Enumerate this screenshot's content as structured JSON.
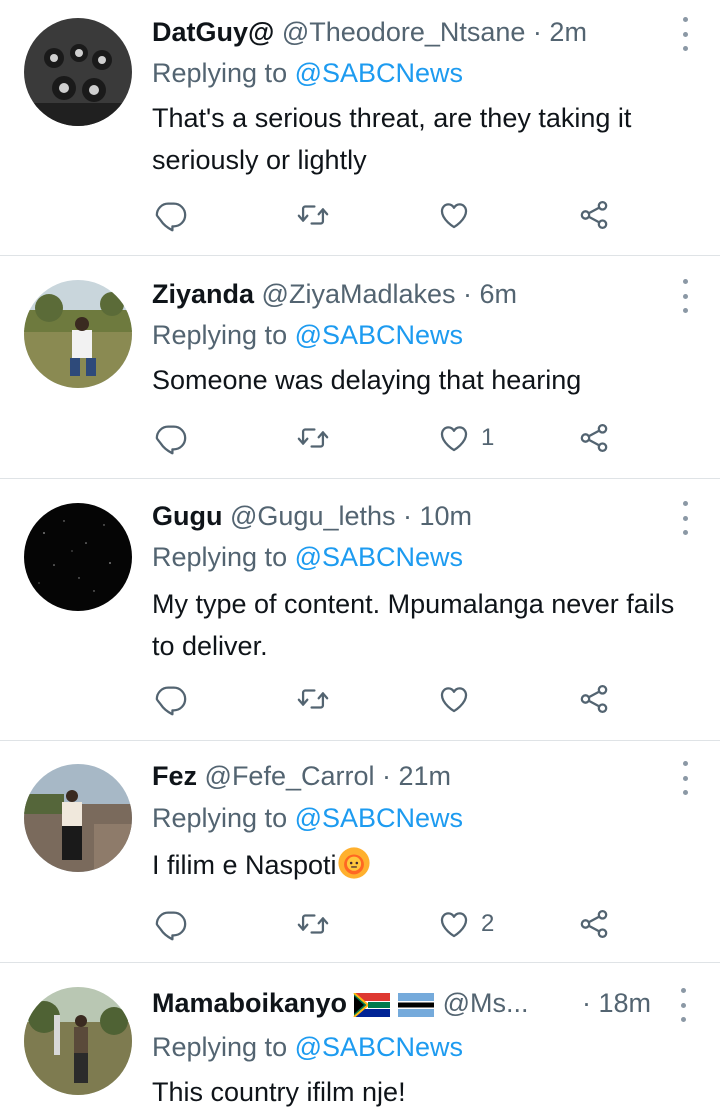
{
  "replying_label": "Replying to",
  "tweets": [
    {
      "name": "DatGuy@",
      "handle": "@Theodore_Ntsane",
      "dot": " · ",
      "time": "2m",
      "mention": "@SABCNews",
      "text": "That's a serious threat, are they taking it seriously or lightly",
      "likes": ""
    },
    {
      "name": "Ziyanda",
      "handle": "@ZiyaMadlakes",
      "dot": " · ",
      "time": "6m",
      "mention": "@SABCNews",
      "text": "Someone was delaying that hearing",
      "likes": "1"
    },
    {
      "name": "Gugu",
      "handle": "@Gugu_leths",
      "dot": " · ",
      "time": "10m",
      "mention": "@SABCNews",
      "text": "My type of content. Mpumalanga never fails to deliver.",
      "likes": ""
    },
    {
      "name": "Fez",
      "handle": "@Fefe_Carrol",
      "dot": " · ",
      "time": "21m",
      "mention": "@SABCNews",
      "text": "I filim e Naspoti",
      "likes": "2"
    },
    {
      "name": "Mamaboikanyo",
      "handle": "@Ms...",
      "dot": " · ",
      "time": "18m",
      "mention": "@SABCNews",
      "text": "This country ifilm nje!",
      "likes": ""
    }
  ],
  "icons": {
    "reply": "reply-icon",
    "retweet": "retweet-icon",
    "like": "like-icon",
    "share": "share-icon",
    "menu": "more-options-icon"
  },
  "colors": {
    "link": "#1d9bf0",
    "muted": "#536471",
    "text": "#0f1419"
  }
}
